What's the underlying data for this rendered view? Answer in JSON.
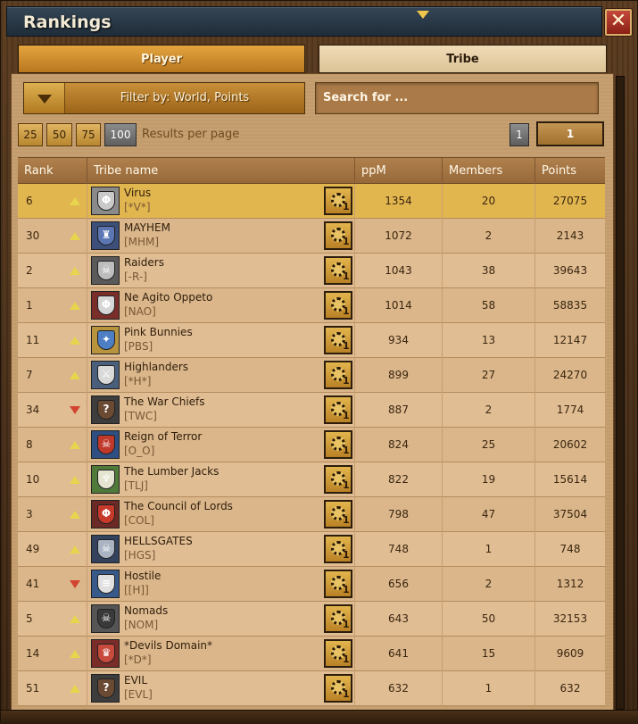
{
  "window": {
    "title": "Rankings",
    "close_label": "✕"
  },
  "tabs": [
    {
      "label": "Player",
      "active": true
    },
    {
      "label": "Tribe",
      "active": false
    }
  ],
  "filter": {
    "label": "Filter by: World, Points"
  },
  "search": {
    "placeholder": "Search for ..."
  },
  "per_page": {
    "options": [
      "25",
      "50",
      "75",
      "100"
    ],
    "selected": "100",
    "label": "Results per page"
  },
  "pagination": {
    "page_button": "1",
    "current_page": "1"
  },
  "table": {
    "headers": {
      "rank": "Rank",
      "tribe": "Tribe name",
      "ppm": "ppM",
      "members": "Members",
      "points": "Points"
    },
    "rows": [
      {
        "rank": "6",
        "trend": "up",
        "name": "Virus",
        "tag": "[*V*]",
        "ppm": "1354",
        "members": "20",
        "points": "27075",
        "emblem_color": "#8a8a8a",
        "shield_color": "#c9c9c9",
        "glyph": "Φ"
      },
      {
        "rank": "30",
        "trend": "up",
        "name": "MAYHEM",
        "tag": "[MHM]",
        "ppm": "1072",
        "members": "2",
        "points": "2143",
        "emblem_color": "#3b4f78",
        "shield_color": "#5b76b3",
        "glyph": "♜"
      },
      {
        "rank": "2",
        "trend": "up",
        "name": "Raiders",
        "tag": "[-R-]",
        "ppm": "1043",
        "members": "38",
        "points": "39643",
        "emblem_color": "#5a5a5a",
        "shield_color": "#bdbdbd",
        "glyph": "☠"
      },
      {
        "rank": "1",
        "trend": "up",
        "name": "Ne Agito Oppeto",
        "tag": "[NAO]",
        "ppm": "1014",
        "members": "58",
        "points": "58835",
        "emblem_color": "#7a2e2a",
        "shield_color": "#d6d6d6",
        "glyph": "Φ"
      },
      {
        "rank": "11",
        "trend": "up",
        "name": "Pink Bunnies",
        "tag": "[PBS]",
        "ppm": "934",
        "members": "13",
        "points": "12147",
        "emblem_color": "#b8943e",
        "shield_color": "#4e7fc4",
        "glyph": "✦"
      },
      {
        "rank": "7",
        "trend": "up",
        "name": "Highlanders",
        "tag": "[*H*]",
        "ppm": "899",
        "members": "27",
        "points": "24270",
        "emblem_color": "#4a5f7c",
        "shield_color": "#d9d9d9",
        "glyph": "⚔"
      },
      {
        "rank": "34",
        "trend": "down",
        "name": "The War Chiefs",
        "tag": "[TWC]",
        "ppm": "887",
        "members": "2",
        "points": "1774",
        "emblem_color": "#3d3d3d",
        "shield_color": "#6b4a33",
        "glyph": "?"
      },
      {
        "rank": "8",
        "trend": "up",
        "name": "Reign of Terror",
        "tag": "[O_O]",
        "ppm": "824",
        "members": "25",
        "points": "20602",
        "emblem_color": "#2f4f82",
        "shield_color": "#c0392b",
        "glyph": "☠"
      },
      {
        "rank": "10",
        "trend": "up",
        "name": "The Lumber Jacks",
        "tag": "[TLJ]",
        "ppm": "822",
        "members": "19",
        "points": "15614",
        "emblem_color": "#4f7a3a",
        "shield_color": "#e4e4d0",
        "glyph": "♆"
      },
      {
        "rank": "3",
        "trend": "up",
        "name": "The Council of Lords",
        "tag": "[COL]",
        "ppm": "798",
        "members": "47",
        "points": "37504",
        "emblem_color": "#6b2a25",
        "shield_color": "#c73a2a",
        "glyph": "Φ"
      },
      {
        "rank": "49",
        "trend": "up",
        "name": "HELLSGATES",
        "tag": "[HGS]",
        "ppm": "748",
        "members": "1",
        "points": "748",
        "emblem_color": "#33435e",
        "shield_color": "#aab3c2",
        "glyph": "☠"
      },
      {
        "rank": "41",
        "trend": "down",
        "name": "Hostile",
        "tag": "[[H]]",
        "ppm": "656",
        "members": "2",
        "points": "1312",
        "emblem_color": "#375a8a",
        "shield_color": "#e0e0e0",
        "glyph": "≡"
      },
      {
        "rank": "5",
        "trend": "up",
        "name": "Nomads",
        "tag": "[NOM]",
        "ppm": "643",
        "members": "50",
        "points": "32153",
        "emblem_color": "#555555",
        "shield_color": "#3a3a3a",
        "glyph": "☠"
      },
      {
        "rank": "14",
        "trend": "up",
        "name": "*Devils Domain*",
        "tag": "[*D*]",
        "ppm": "641",
        "members": "15",
        "points": "9609",
        "emblem_color": "#7a2c28",
        "shield_color": "#c84a3c",
        "glyph": "♛"
      },
      {
        "rank": "51",
        "trend": "up",
        "name": "EVIL",
        "tag": "[EVL]",
        "ppm": "632",
        "members": "1",
        "points": "632",
        "emblem_color": "#3d3d3d",
        "shield_color": "#6b4a33",
        "glyph": "?"
      }
    ]
  },
  "colors": {
    "highlight_row": "#e2b64f",
    "trend_up": "#e7d54e",
    "trend_down": "#d2442f",
    "accent_gold": "#c89039"
  },
  "icons": {
    "trend_up": "triangle-up-icon",
    "trend_down": "triangle-down-icon",
    "profile": "tribe-profile-icon",
    "sort": "sort-desc-icon"
  }
}
